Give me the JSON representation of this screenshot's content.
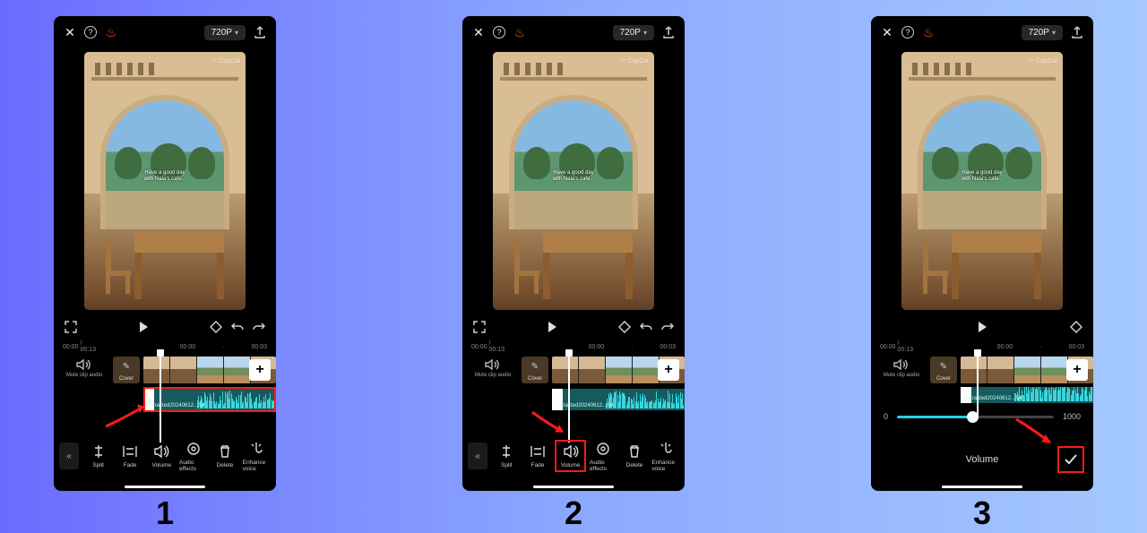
{
  "steps": [
    "1",
    "2",
    "3"
  ],
  "topbar": {
    "resolution": "720P"
  },
  "preview": {
    "watermark": "✂ CapCut",
    "caption_l1": "Have a good day",
    "caption_l2": "with Nala's cafe..."
  },
  "timeruler": {
    "t_cur": "00:00",
    "t_dur": "/ 00:13",
    "m1": "00:00",
    "m2": "00:03"
  },
  "timeline": {
    "mute_label": "Mute clip audio",
    "cover_label": "Cover",
    "audio_label": "Extracted20240612…54",
    "add": "+"
  },
  "toolbar": {
    "split": "Split",
    "fade": "Fade",
    "volume": "Volume",
    "fx": "Audio effects",
    "delete": "Delete",
    "enhance": "Enhance voice"
  },
  "slider": {
    "min": "0",
    "max": "1000",
    "value_pct": 48
  },
  "volume_panel": {
    "label": "Volume"
  }
}
